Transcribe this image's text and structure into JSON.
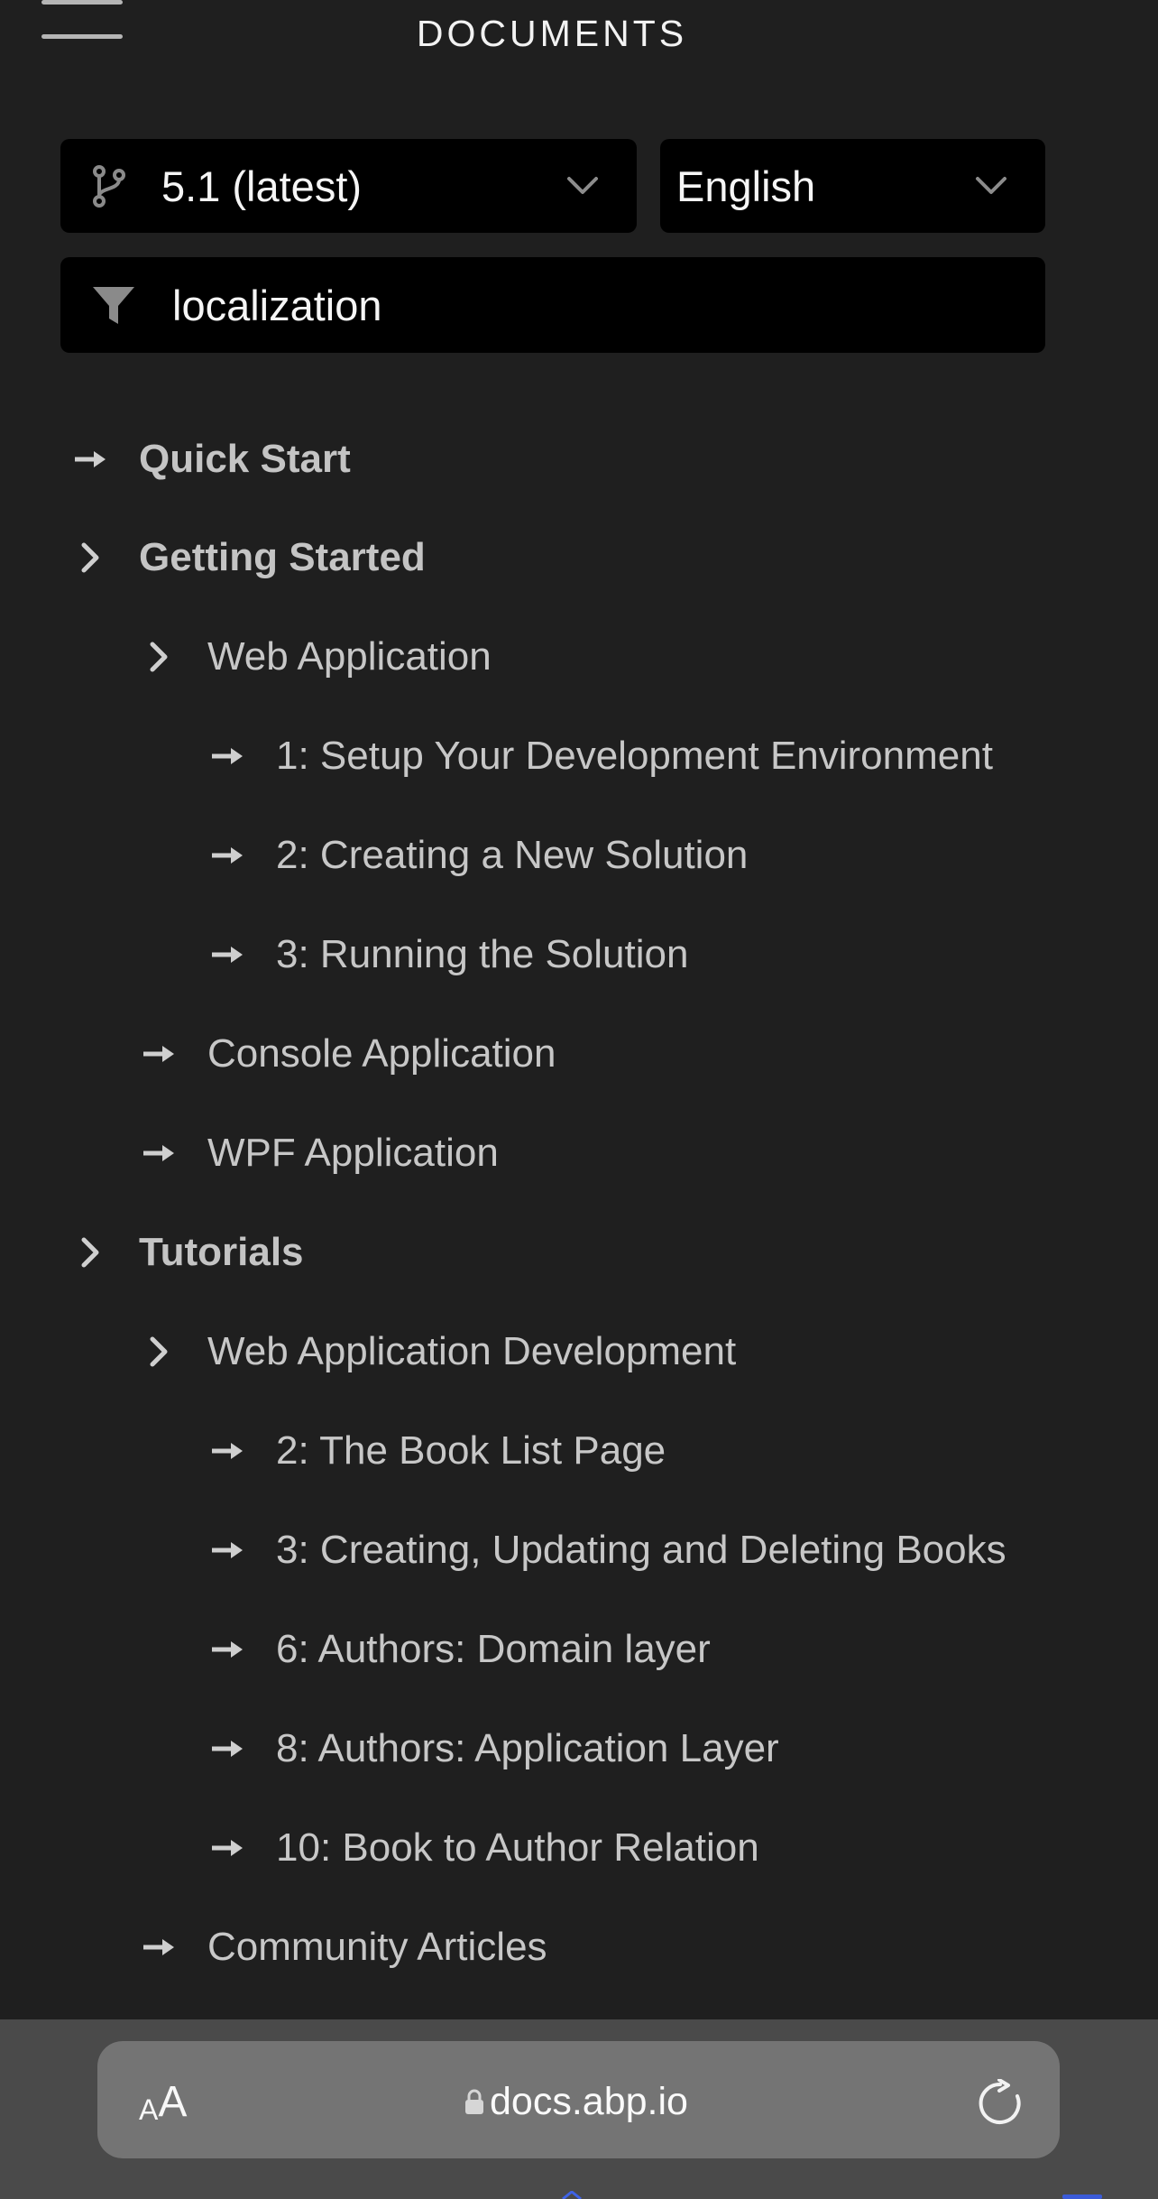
{
  "header": {
    "title": "DOCUMENTS",
    "menu_icon": "hamburger-menu-icon"
  },
  "version_select": {
    "value": "5.1 (latest)",
    "icon": "git-branch-icon",
    "chevron": "chevron-down-icon"
  },
  "language_select": {
    "value": "English",
    "chevron": "chevron-down-icon"
  },
  "filter": {
    "value": "localization",
    "icon": "filter-funnel-icon"
  },
  "nav": {
    "items": [
      {
        "label": "Quick Start",
        "icon": "arrow-right-icon"
      },
      {
        "label": "Getting Started",
        "icon": "chevron-right-icon"
      },
      {
        "label": "Web Application",
        "icon": "chevron-right-icon"
      },
      {
        "label": "1: Setup Your Development Environment",
        "icon": "arrow-right-icon"
      },
      {
        "label": "2: Creating a New Solution",
        "icon": "arrow-right-icon"
      },
      {
        "label": "3: Running the Solution",
        "icon": "arrow-right-icon"
      },
      {
        "label": "Console Application",
        "icon": "arrow-right-icon"
      },
      {
        "label": "WPF Application",
        "icon": "arrow-right-icon"
      },
      {
        "label": "Tutorials",
        "icon": "chevron-right-icon"
      },
      {
        "label": "Web Application Development",
        "icon": "chevron-right-icon"
      },
      {
        "label": "2: The Book List Page",
        "icon": "arrow-right-icon"
      },
      {
        "label": "3: Creating, Updating and Deleting Books",
        "icon": "arrow-right-icon"
      },
      {
        "label": "6: Authors: Domain layer",
        "icon": "arrow-right-icon"
      },
      {
        "label": "8: Authors: Application Layer",
        "icon": "arrow-right-icon"
      },
      {
        "label": "10: Book to Author Relation",
        "icon": "arrow-right-icon"
      },
      {
        "label": "Community Articles",
        "icon": "arrow-right-icon"
      }
    ]
  },
  "browser": {
    "text_size_small": "A",
    "text_size_big": "A",
    "url": "docs.abp.io",
    "lock_icon": "lock-icon",
    "reload_icon": "reload-icon"
  },
  "colors": {
    "background": "#1f1f1f",
    "field_background": "#000000",
    "text": "#c7c7c7",
    "browser_bar": "#4a4a4a",
    "url_pill": "#747474"
  }
}
